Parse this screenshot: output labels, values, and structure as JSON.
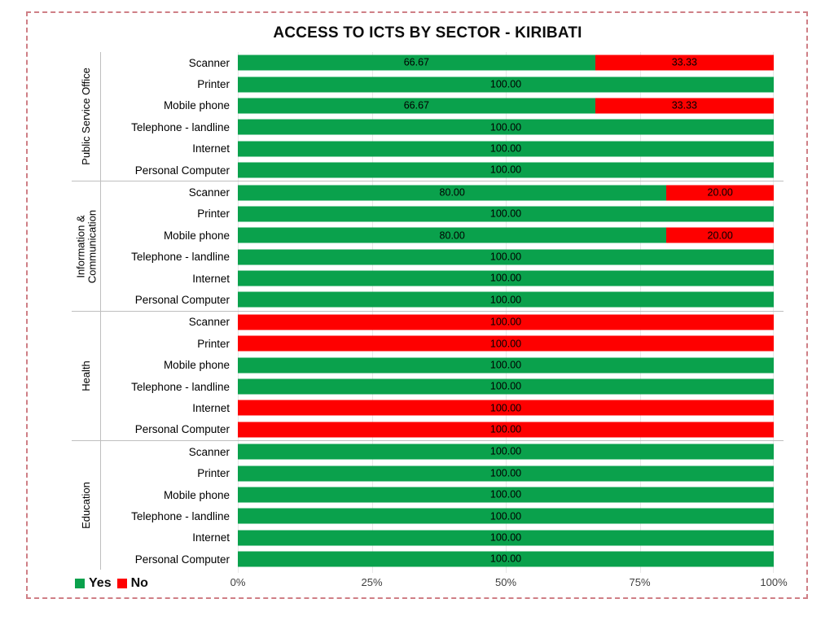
{
  "title": "ACCESS TO ICTS BY SECTOR - KIRIBATI",
  "colors": {
    "yes": "#0aa14c",
    "no": "#fe0000",
    "frame": "#cf7f86",
    "gridline": "#e8e8e8"
  },
  "legend": {
    "items": [
      {
        "label": "Yes",
        "key": "yes"
      },
      {
        "label": "No",
        "key": "no"
      }
    ]
  },
  "axis": {
    "ticks": [
      "0%",
      "25%",
      "50%",
      "75%",
      "100%"
    ],
    "tick_values": [
      0,
      25,
      50,
      75,
      100
    ],
    "min": 0,
    "max": 100
  },
  "chart_data": {
    "type": "bar",
    "orientation": "horizontal",
    "stacked": true,
    "stacked_100": true,
    "title": "ACCESS TO ICTS BY SECTOR - KIRIBATI",
    "xlabel": "",
    "ylabel": "",
    "xlim": [
      0,
      100
    ],
    "xticks": [
      0,
      25,
      50,
      75,
      100
    ],
    "xticklabels": [
      "0%",
      "25%",
      "50%",
      "75%",
      "100%"
    ],
    "grid": true,
    "legend": [
      "Yes",
      "No"
    ],
    "legend_position": "bottom-left",
    "series_colors": {
      "Yes": "#0aa14c",
      "No": "#fe0000"
    },
    "categories": [
      "Scanner",
      "Printer",
      "Mobile phone",
      "Telephone - landline",
      "Internet",
      "Personal Computer"
    ],
    "groups": [
      {
        "sector": "Public Service Office",
        "sector_lines": [
          "Public Service Office"
        ],
        "rows": [
          {
            "label": "Scanner",
            "segments": [
              {
                "series": "Yes",
                "value": 66.67,
                "text": "66.67"
              },
              {
                "series": "No",
                "value": 33.33,
                "text": "33.33"
              }
            ]
          },
          {
            "label": "Printer",
            "segments": [
              {
                "series": "Yes",
                "value": 100.0,
                "text": "100.00"
              }
            ]
          },
          {
            "label": "Mobile phone",
            "segments": [
              {
                "series": "Yes",
                "value": 66.67,
                "text": "66.67"
              },
              {
                "series": "No",
                "value": 33.33,
                "text": "33.33"
              }
            ]
          },
          {
            "label": "Telephone - landline",
            "segments": [
              {
                "series": "Yes",
                "value": 100.0,
                "text": "100.00"
              }
            ]
          },
          {
            "label": "Internet",
            "segments": [
              {
                "series": "Yes",
                "value": 100.0,
                "text": "100.00"
              }
            ]
          },
          {
            "label": "Personal Computer",
            "segments": [
              {
                "series": "Yes",
                "value": 100.0,
                "text": "100.00"
              }
            ]
          }
        ]
      },
      {
        "sector": "Information & Communication",
        "sector_lines": [
          "Information &",
          "Communication"
        ],
        "rows": [
          {
            "label": "Scanner",
            "segments": [
              {
                "series": "Yes",
                "value": 80.0,
                "text": "80.00"
              },
              {
                "series": "No",
                "value": 20.0,
                "text": "20.00"
              }
            ]
          },
          {
            "label": "Printer",
            "segments": [
              {
                "series": "Yes",
                "value": 100.0,
                "text": "100.00"
              }
            ]
          },
          {
            "label": "Mobile phone",
            "segments": [
              {
                "series": "Yes",
                "value": 80.0,
                "text": "80.00"
              },
              {
                "series": "No",
                "value": 20.0,
                "text": "20.00"
              }
            ]
          },
          {
            "label": "Telephone - landline",
            "segments": [
              {
                "series": "Yes",
                "value": 100.0,
                "text": "100.00"
              }
            ]
          },
          {
            "label": "Internet",
            "segments": [
              {
                "series": "Yes",
                "value": 100.0,
                "text": "100.00"
              }
            ]
          },
          {
            "label": "Personal Computer",
            "segments": [
              {
                "series": "Yes",
                "value": 100.0,
                "text": "100.00"
              }
            ]
          }
        ]
      },
      {
        "sector": "Health",
        "sector_lines": [
          "Health"
        ],
        "rows": [
          {
            "label": "Scanner",
            "segments": [
              {
                "series": "No",
                "value": 100.0,
                "text": "100.00"
              }
            ]
          },
          {
            "label": "Printer",
            "segments": [
              {
                "series": "No",
                "value": 100.0,
                "text": "100.00"
              }
            ]
          },
          {
            "label": "Mobile phone",
            "segments": [
              {
                "series": "Yes",
                "value": 100.0,
                "text": "100.00"
              }
            ]
          },
          {
            "label": "Telephone - landline",
            "segments": [
              {
                "series": "Yes",
                "value": 100.0,
                "text": "100.00"
              }
            ]
          },
          {
            "label": "Internet",
            "segments": [
              {
                "series": "No",
                "value": 100.0,
                "text": "100.00"
              }
            ]
          },
          {
            "label": "Personal Computer",
            "segments": [
              {
                "series": "No",
                "value": 100.0,
                "text": "100.00"
              }
            ]
          }
        ]
      },
      {
        "sector": "Education",
        "sector_lines": [
          "Education"
        ],
        "rows": [
          {
            "label": "Scanner",
            "segments": [
              {
                "series": "Yes",
                "value": 100.0,
                "text": "100.00"
              }
            ]
          },
          {
            "label": "Printer",
            "segments": [
              {
                "series": "Yes",
                "value": 100.0,
                "text": "100.00"
              }
            ]
          },
          {
            "label": "Mobile phone",
            "segments": [
              {
                "series": "Yes",
                "value": 100.0,
                "text": "100.00"
              }
            ]
          },
          {
            "label": "Telephone - landline",
            "segments": [
              {
                "series": "Yes",
                "value": 100.0,
                "text": "100.00"
              }
            ]
          },
          {
            "label": "Internet",
            "segments": [
              {
                "series": "Yes",
                "value": 100.0,
                "text": "100.00"
              }
            ]
          },
          {
            "label": "Personal Computer",
            "segments": [
              {
                "series": "Yes",
                "value": 100.0,
                "text": "100.00"
              }
            ]
          }
        ]
      }
    ]
  }
}
